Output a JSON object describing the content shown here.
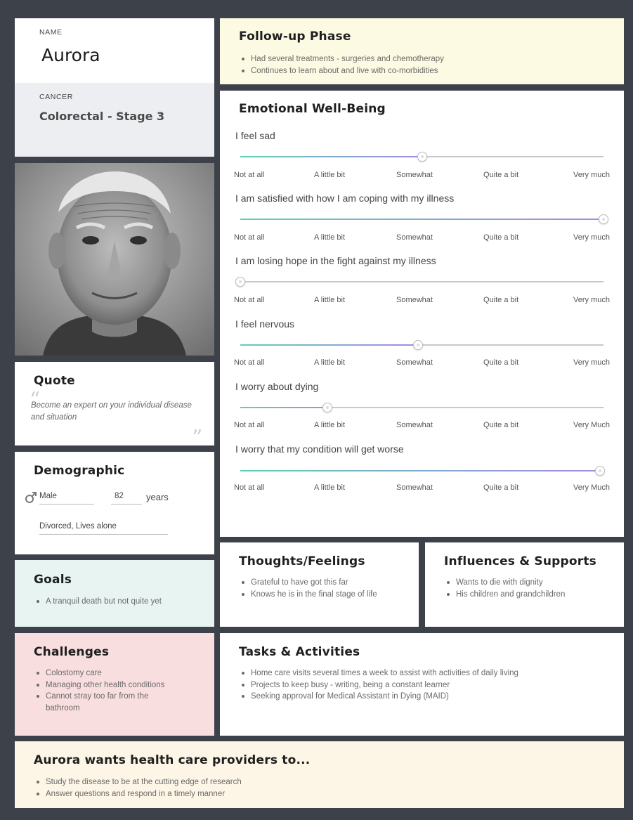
{
  "profile": {
    "name_label": "NAME",
    "name": "Aurora",
    "cancer_label": "CANCER",
    "cancer": "Colorectal - Stage 3",
    "photo": "elderly-man-portrait"
  },
  "quote": {
    "title": "Quote",
    "text": "Become an expert on your individual disease and situation"
  },
  "demographic": {
    "title": "Demographic",
    "gender_icon": "male-symbol-icon",
    "gender": "Male",
    "age": "82",
    "age_unit": "years",
    "living": "Divorced, Lives alone"
  },
  "goals": {
    "title": "Goals",
    "items": [
      "A tranquil death but not quite yet"
    ]
  },
  "challenges": {
    "title": "Challenges",
    "items": [
      "Colostomy care",
      "Managing other health conditions",
      "Cannot stray too far from the bathroom"
    ]
  },
  "followup": {
    "title": "Follow-up Phase",
    "items": [
      "Had several treatments  - surgeries and chemotherapy",
      "Continues to learn about and live with co-morbidities"
    ]
  },
  "wellbeing": {
    "title": "Emotional Well-Being",
    "items": [
      {
        "question": "I feel sad",
        "level": 0.5,
        "labels": [
          "Not at all",
          "A little bit",
          "Somewhat",
          "Quite a bit",
          "Very much"
        ]
      },
      {
        "question": "I am satisfied with how I am coping with my illness",
        "level": 1.0,
        "labels": [
          "Not at all",
          "A little bit",
          "Somewhat",
          "Quite a bit",
          "Very much"
        ]
      },
      {
        "question": "I am losing hope in the fight against my illness",
        "level": 0.0,
        "labels": [
          "Not at all",
          "A little bit",
          "Somewhat",
          "Quite a bit",
          "Very much"
        ]
      },
      {
        "question": "I feel nervous",
        "level": 0.49,
        "labels": [
          "Not at all",
          "A little bit",
          "Somewhat",
          "Quite a bit",
          "Very much"
        ]
      },
      {
        "question": "I worry about dying",
        "level": 0.24,
        "labels": [
          "Not at all",
          "A little bit",
          "Somewhat",
          "Quite a bit",
          "Very Much"
        ]
      },
      {
        "question": "I worry that my condition will get worse",
        "level": 0.99,
        "labels": [
          "Not at all",
          "A little bit",
          "Somewhat",
          "Quite a bit",
          "Very Much"
        ]
      }
    ]
  },
  "thoughts": {
    "title": "Thoughts/Feelings",
    "items": [
      "Grateful to have got this far",
      "Knows he is in the final stage of life"
    ]
  },
  "influences": {
    "title": "Influences & Supports",
    "items": [
      "Wants to die with dignity",
      "His children and grandchildren"
    ]
  },
  "tasks": {
    "title": "Tasks & Activities",
    "items": [
      "Home care visits several times a week to assist with activities of daily living",
      "Projects to keep busy - writing, being a constant learner",
      "Seeking approval for Medical Assistant in Dying (MAID)"
    ]
  },
  "wants": {
    "title": "Aurora wants health care providers to...",
    "items": [
      "Study the disease to be at the cutting edge of research",
      "Answer questions and respond in a timely manner"
    ]
  }
}
